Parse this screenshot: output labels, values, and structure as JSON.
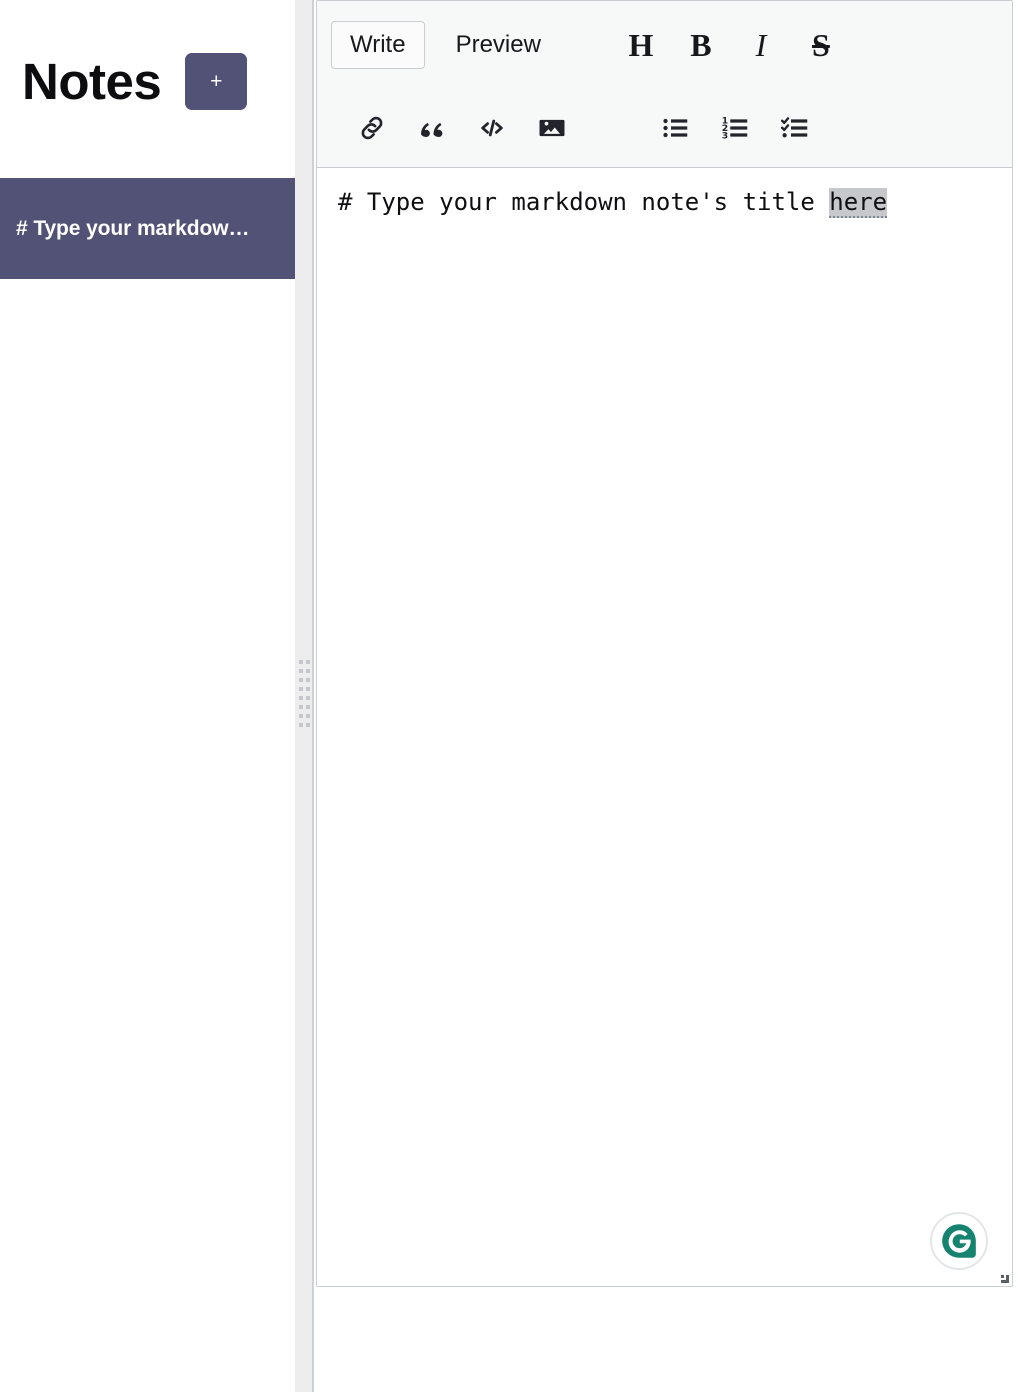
{
  "sidebar": {
    "title": "Notes",
    "add_button_label": "+",
    "add_button_color": "#515275",
    "selected_item_color": "#515275",
    "notes": [
      {
        "label": "# Type your markdow…",
        "selected": true
      }
    ]
  },
  "splitter": {
    "grip_icon": "drag-grip-icon",
    "dot_count": 16
  },
  "editor": {
    "tabs": [
      {
        "id": "write",
        "label": "Write",
        "active": true
      },
      {
        "id": "preview",
        "label": "Preview",
        "active": false
      }
    ],
    "text_format_buttons": [
      {
        "id": "heading",
        "label": "H",
        "icon": "heading-icon"
      },
      {
        "id": "bold",
        "label": "B",
        "icon": "bold-icon"
      },
      {
        "id": "italic",
        "label": "I",
        "icon": "italic-icon"
      },
      {
        "id": "strikethrough",
        "label": "S",
        "icon": "strikethrough-icon"
      }
    ],
    "insert_buttons": [
      {
        "id": "link",
        "icon": "link-icon"
      },
      {
        "id": "quote",
        "icon": "quote-icon"
      },
      {
        "id": "code",
        "icon": "code-icon"
      },
      {
        "id": "image",
        "icon": "image-icon"
      }
    ],
    "list_buttons": [
      {
        "id": "unordered-list",
        "icon": "unordered-list-icon"
      },
      {
        "id": "ordered-list",
        "icon": "ordered-list-icon"
      },
      {
        "id": "checklist",
        "icon": "checklist-icon"
      }
    ],
    "content": {
      "before_selection": "# Type your markdown note's title ",
      "selection": "here",
      "full_text": "# Type your markdown note's title here"
    },
    "grammarly": {
      "icon": "grammarly-icon",
      "letter": "G",
      "color": "#15836f"
    },
    "resize_handle_icon": "resize-handle-icon"
  }
}
